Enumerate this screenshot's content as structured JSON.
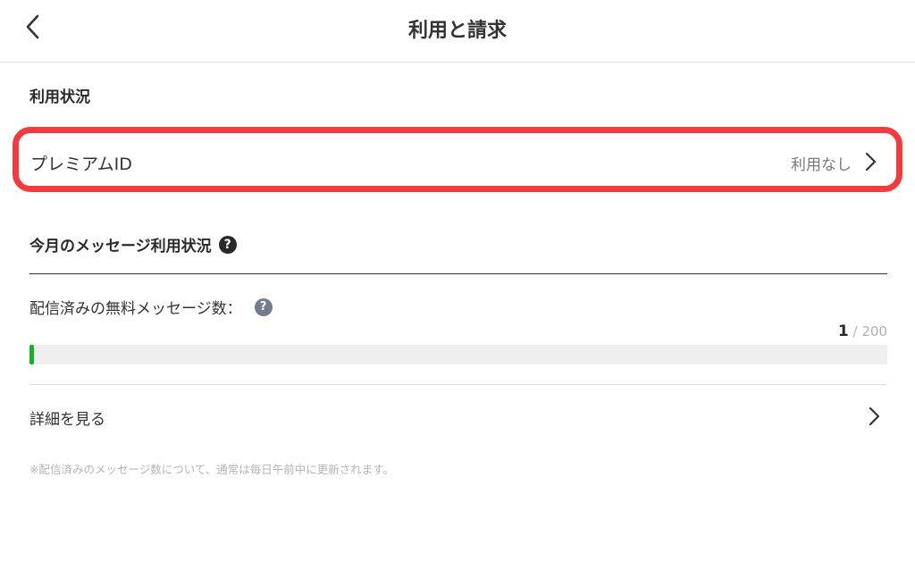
{
  "header": {
    "title": "利用と請求",
    "back_icon": "chevron-left-icon"
  },
  "usage": {
    "section_title": "利用状況",
    "premium_label": "プレミアムID",
    "premium_value": "利用なし"
  },
  "messages": {
    "title": "今月のメッセージ利用状況",
    "help_glyph": "?",
    "sent_label": "配信済みの無料メッセージ数：",
    "count_current": "1",
    "count_separator": " / ",
    "count_total": "200",
    "progress_fraction": 0.005,
    "progress_color": "#16b22a",
    "detail_label": "詳細を見る",
    "footnote": "※配信済みのメッセージ数について、通常は毎日午前中に更新されます。"
  },
  "colors": {
    "highlight": "#f23b3f",
    "text": "#333333",
    "muted": "#7a7a7a"
  }
}
